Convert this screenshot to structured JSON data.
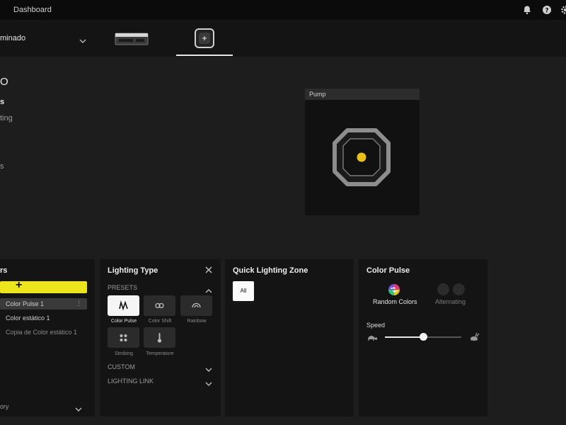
{
  "topbar": {
    "title": "Dashboard",
    "icons": [
      "bell-icon",
      "help-icon",
      "settings-icon"
    ]
  },
  "device_bar": {
    "device_name": "minado",
    "tabs": [
      "ram-device",
      "pump-device"
    ],
    "selected_tab": 1
  },
  "sidebar": {
    "items": [
      "O",
      "s",
      "ting",
      "s"
    ]
  },
  "pump_view": {
    "title": "Pump",
    "led_color": "#e8c21a"
  },
  "layers_panel": {
    "title": "rs",
    "add_label": "+",
    "layers": [
      {
        "label": "Color Pulse 1",
        "selected": true
      },
      {
        "label": "Color estático 1",
        "selected": false
      },
      {
        "label": "Copia de Color estático 1",
        "selected": false
      }
    ],
    "footer_label": "ory"
  },
  "lighting_type_panel": {
    "title": "Lighting Type",
    "presets_label": "PRESETS",
    "presets": [
      {
        "label": "Color Pulse",
        "icon": "color-pulse-icon",
        "active": true
      },
      {
        "label": "Color Shift",
        "icon": "color-shift-icon",
        "active": false
      },
      {
        "label": "Rainbow",
        "icon": "rainbow-icon",
        "active": false
      },
      {
        "label": "Strobing",
        "icon": "strobing-icon",
        "active": false
      },
      {
        "label": "Temperature",
        "icon": "temperature-icon",
        "active": false
      }
    ],
    "custom_label": "CUSTOM",
    "lighting_link_label": "LIGHTING LINK"
  },
  "quick_zone_panel": {
    "title": "Quick Lighting Zone",
    "all_label": "All"
  },
  "color_pulse_panel": {
    "title": "Color Pulse",
    "random_label": "Random Colors",
    "alternating_label": "Alternating",
    "speed_label": "Speed",
    "speed_value": 0.5
  },
  "colors": {
    "accent": "#ede61c",
    "background": "#1d1d1d",
    "panel": "#141414"
  }
}
